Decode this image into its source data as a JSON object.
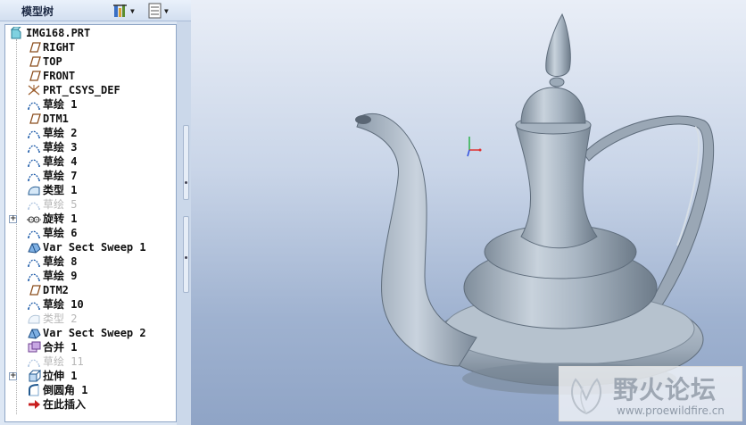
{
  "panel": {
    "title": "模型树",
    "settings_icon": "tree-settings-icon",
    "show_icon": "tree-show-icon"
  },
  "tree": {
    "root": {
      "label": "IMG168.PRT",
      "icon": "part-icon"
    },
    "items": [
      {
        "label": "RIGHT",
        "icon": "datum-plane-icon",
        "dim": false,
        "expander": false
      },
      {
        "label": "TOP",
        "icon": "datum-plane-icon",
        "dim": false,
        "expander": false
      },
      {
        "label": "FRONT",
        "icon": "datum-plane-icon",
        "dim": false,
        "expander": false
      },
      {
        "label": "PRT_CSYS_DEF",
        "icon": "csys-icon",
        "dim": false,
        "expander": false
      },
      {
        "label": "草绘 1",
        "icon": "sketch-icon",
        "dim": false,
        "expander": false
      },
      {
        "label": "DTM1",
        "icon": "datum-plane-icon",
        "dim": false,
        "expander": false
      },
      {
        "label": "草绘 2",
        "icon": "sketch-icon",
        "dim": false,
        "expander": false
      },
      {
        "label": "草绘 3",
        "icon": "sketch-icon",
        "dim": false,
        "expander": false
      },
      {
        "label": "草绘 4",
        "icon": "sketch-icon",
        "dim": false,
        "expander": false
      },
      {
        "label": "草绘 7",
        "icon": "sketch-icon",
        "dim": false,
        "expander": false
      },
      {
        "label": "类型 1",
        "icon": "surface-icon",
        "dim": false,
        "expander": false
      },
      {
        "label": "草绘 5",
        "icon": "sketch-icon",
        "dim": true,
        "expander": false
      },
      {
        "label": "旋转 1",
        "icon": "revolve-icon",
        "dim": false,
        "expander": true
      },
      {
        "label": "草绘 6",
        "icon": "sketch-icon",
        "dim": false,
        "expander": false
      },
      {
        "label": "Var Sect Sweep 1",
        "icon": "sweep-icon",
        "dim": false,
        "expander": false
      },
      {
        "label": "草绘 8",
        "icon": "sketch-icon",
        "dim": false,
        "expander": false
      },
      {
        "label": "草绘 9",
        "icon": "sketch-icon",
        "dim": false,
        "expander": false
      },
      {
        "label": "DTM2",
        "icon": "datum-plane-icon",
        "dim": false,
        "expander": false
      },
      {
        "label": "草绘 10",
        "icon": "sketch-icon",
        "dim": false,
        "expander": false
      },
      {
        "label": "类型 2",
        "icon": "surface-icon",
        "dim": true,
        "expander": false
      },
      {
        "label": "Var Sect Sweep 2",
        "icon": "sweep-icon",
        "dim": false,
        "expander": false
      },
      {
        "label": "合并 1",
        "icon": "merge-icon",
        "dim": false,
        "expander": false
      },
      {
        "label": "草绘 11",
        "icon": "sketch-icon",
        "dim": true,
        "expander": false
      },
      {
        "label": "拉伸 1",
        "icon": "extrude-icon",
        "dim": false,
        "expander": true
      },
      {
        "label": "倒圆角 1",
        "icon": "round-icon",
        "dim": false,
        "expander": false
      },
      {
        "label": "在此插入",
        "icon": "insert-here-arrow-icon",
        "dim": false,
        "expander": false
      }
    ]
  },
  "viewport": {
    "model": "teapot-model",
    "triad": "coordinate-triad-icon"
  },
  "watermark": {
    "text": "野火论坛",
    "url": "www.proewildfire.cn",
    "logo": "watermark-logo-icon"
  },
  "colors": {
    "tree_border": "#8fa6c6",
    "panel_bg": "#dde7f4",
    "model_body": "#aab7c4",
    "viewport_top": "#e9eef7",
    "viewport_bottom": "#8fa4c6"
  }
}
